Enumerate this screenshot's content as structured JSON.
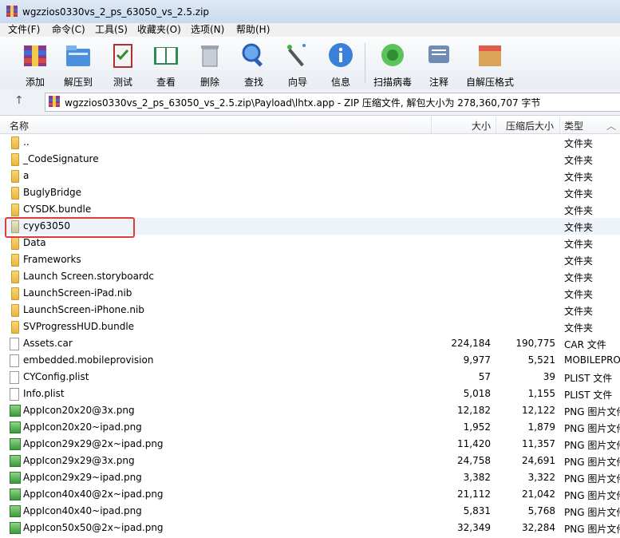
{
  "window": {
    "title": "wgzzios0330vs_2_ps_63050_vs_2.5.zip"
  },
  "menu": [
    "文件(F)",
    "命令(C)",
    "工具(S)",
    "收藏夹(O)",
    "选项(N)",
    "帮助(H)"
  ],
  "toolbar": [
    "添加",
    "解压到",
    "测试",
    "查看",
    "删除",
    "查找",
    "向导",
    "信息",
    "扫描病毒",
    "注释",
    "自解压格式"
  ],
  "address": {
    "path": "wgzzios0330vs_2_ps_63050_vs_2.5.zip\\Payload\\lhtx.app - ZIP 压缩文件, 解包大小为 278,360,707 字节"
  },
  "columns": {
    "name": "名称",
    "size": "大小",
    "packed": "压缩后大小",
    "type": "类型"
  },
  "rows": [
    {
      "name": "..",
      "size": "",
      "packed": "",
      "type": "文件夹",
      "kind": "folder"
    },
    {
      "name": "_CodeSignature",
      "size": "",
      "packed": "",
      "type": "文件夹",
      "kind": "folder"
    },
    {
      "name": "a",
      "size": "",
      "packed": "",
      "type": "文件夹",
      "kind": "folder"
    },
    {
      "name": "BuglyBridge",
      "size": "",
      "packed": "",
      "type": "文件夹",
      "kind": "folder"
    },
    {
      "name": "CYSDK.bundle",
      "size": "",
      "packed": "",
      "type": "文件夹",
      "kind": "folder"
    },
    {
      "name": "cyy63050",
      "size": "",
      "packed": "",
      "type": "文件夹",
      "kind": "folder-selected"
    },
    {
      "name": "Data",
      "size": "",
      "packed": "",
      "type": "文件夹",
      "kind": "folder"
    },
    {
      "name": "Frameworks",
      "size": "",
      "packed": "",
      "type": "文件夹",
      "kind": "folder"
    },
    {
      "name": "Launch Screen.storyboardc",
      "size": "",
      "packed": "",
      "type": "文件夹",
      "kind": "folder"
    },
    {
      "name": "LaunchScreen-iPad.nib",
      "size": "",
      "packed": "",
      "type": "文件夹",
      "kind": "folder"
    },
    {
      "name": "LaunchScreen-iPhone.nib",
      "size": "",
      "packed": "",
      "type": "文件夹",
      "kind": "folder"
    },
    {
      "name": "SVProgressHUD.bundle",
      "size": "",
      "packed": "",
      "type": "文件夹",
      "kind": "folder"
    },
    {
      "name": "Assets.car",
      "size": "224,184",
      "packed": "190,775",
      "type": "CAR 文件",
      "kind": "file"
    },
    {
      "name": "embedded.mobileprovision",
      "size": "9,977",
      "packed": "5,521",
      "type": "MOBILEPRO",
      "kind": "file"
    },
    {
      "name": "CYConfig.plist",
      "size": "57",
      "packed": "39",
      "type": "PLIST 文件",
      "kind": "file"
    },
    {
      "name": "Info.plist",
      "size": "5,018",
      "packed": "1,155",
      "type": "PLIST 文件",
      "kind": "file"
    },
    {
      "name": "AppIcon20x20@3x.png",
      "size": "12,182",
      "packed": "12,122",
      "type": "PNG 图片文件",
      "kind": "png"
    },
    {
      "name": "AppIcon20x20~ipad.png",
      "size": "1,952",
      "packed": "1,879",
      "type": "PNG 图片文件",
      "kind": "png"
    },
    {
      "name": "AppIcon29x29@2x~ipad.png",
      "size": "11,420",
      "packed": "11,357",
      "type": "PNG 图片文件",
      "kind": "png"
    },
    {
      "name": "AppIcon29x29@3x.png",
      "size": "24,758",
      "packed": "24,691",
      "type": "PNG 图片文件",
      "kind": "png"
    },
    {
      "name": "AppIcon29x29~ipad.png",
      "size": "3,382",
      "packed": "3,322",
      "type": "PNG 图片文件",
      "kind": "png"
    },
    {
      "name": "AppIcon40x40@2x~ipad.png",
      "size": "21,112",
      "packed": "21,042",
      "type": "PNG 图片文件",
      "kind": "png"
    },
    {
      "name": "AppIcon40x40~ipad.png",
      "size": "5,831",
      "packed": "5,768",
      "type": "PNG 图片文件",
      "kind": "png"
    },
    {
      "name": "AppIcon50x50@2x~ipad.png",
      "size": "32,349",
      "packed": "32,284",
      "type": "PNG 图片文件",
      "kind": "png"
    }
  ]
}
